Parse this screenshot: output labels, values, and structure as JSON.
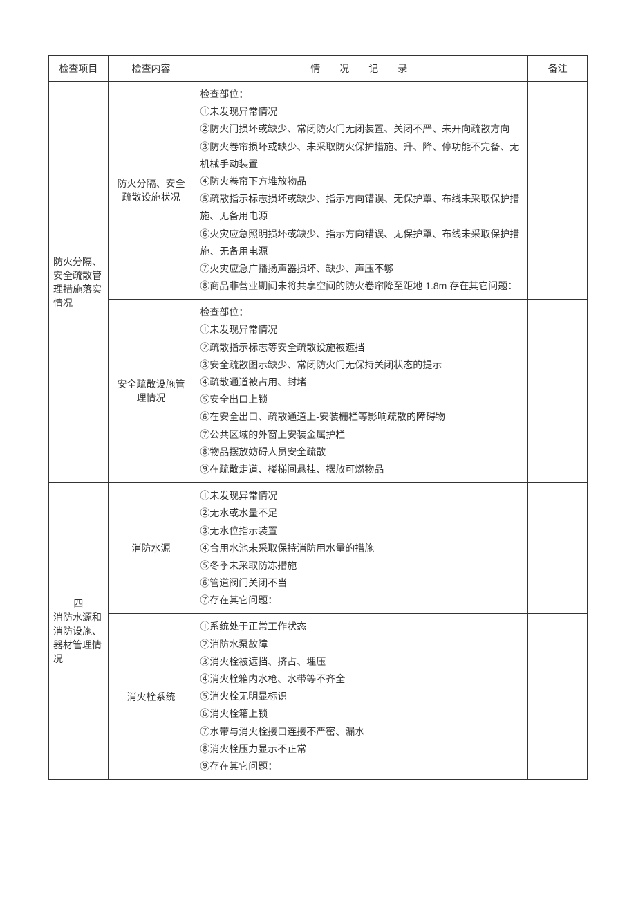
{
  "headers": {
    "col1": "检查项目",
    "col2": "检查内容",
    "col3": "情况记录",
    "col4": "备注"
  },
  "section1": {
    "item": "防火分隔、安全疏散管理措施落实情况",
    "row1": {
      "content": "防火分隔、安全疏散设施状况",
      "lines": [
        "检查部位：",
        "①未发现异常情况",
        "②防火门损坏或缺少、常闭防火门无闭装置、关闭不严、未开向疏散方向",
        "③防火卷帘损坏或缺少、未采取防火保护措施、升、降、停功能不完备、无机械手动装置",
        "④防火卷帘下方堆放物品",
        "⑤疏散指示标志损坏或缺少、指示方向错误、无保护罩、布线未采取保护措施、无备用电源",
        "⑥火灾应急照明损坏或缺少、指示方向错误、无保护罩、布线未采取保护措施、无备用电源",
        "⑦火灾应急广播扬声器损坏、缺少、声压不够",
        "⑧商品非营业期间未将共享空间的防火卷帘降至距地 1.8m 存在其它问题："
      ]
    },
    "row2": {
      "content": "安全疏散设施管理情况",
      "lines": [
        "检查部位：",
        "①未发现异常情况",
        "②疏散指示标志等安全疏散设施被遮挡",
        "③安全疏散图示缺少、常闭防火门无保持关闭状态的提示",
        "④疏散通道被占用、封堵",
        "⑤安全出口上锁",
        "⑥在安全出口、疏散通道上-安装栅栏等影响疏散的障碍物",
        "⑦公共区域的外窗上安装金属护栏",
        "⑧物品摆放妨碍人员安全疏散",
        "⑨在疏散走道、楼梯间悬挂、摆放可燃物品"
      ]
    }
  },
  "section2": {
    "item_line1": "四",
    "item_line2": "消防水源和消防设施、器材管理情况",
    "row1": {
      "content": "消防水源",
      "lines": [
        "①未发现异常情况",
        "②无水或水量不足",
        "③无水位指示装置",
        "④合用水池未采取保持消防用水量的措施",
        "⑤冬季未采取防冻措施",
        "⑥管道阀门关闭不当",
        "⑦存在其它问题："
      ]
    },
    "row2": {
      "content": "消火栓系统",
      "lines": [
        "①系统处于正常工作状态",
        "②消防水泵故障",
        "③消火栓被遮挡、挤占、埋压",
        "④消火栓箱内水枪、水带等不齐全",
        "⑤消火栓无明显标识",
        "⑥消火栓箱上锁",
        "⑦水带与消火栓接口连接不严密、漏水",
        "⑧消火栓压力显示不正常",
        "⑨存在其它问题："
      ]
    }
  }
}
